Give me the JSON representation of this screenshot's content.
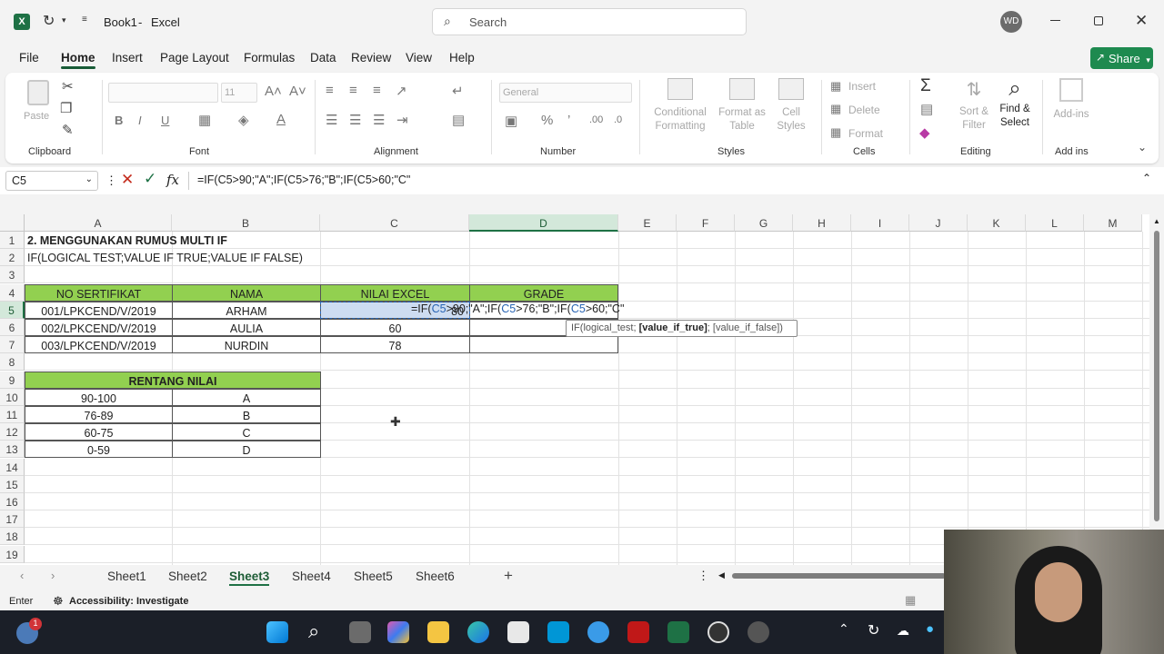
{
  "titlebar": {
    "doc_title": "Book1",
    "separator": "-",
    "app_name": "Excel",
    "search_placeholder": "Search",
    "user_initials": "WD"
  },
  "menu": {
    "items": [
      "File",
      "Home",
      "Insert",
      "Page Layout",
      "Formulas",
      "Data",
      "Review",
      "View",
      "Help"
    ],
    "share": "Share"
  },
  "ribbon": {
    "clipboard": {
      "label": "Clipboard",
      "paste": "Paste"
    },
    "font": {
      "label": "Font",
      "size": "11",
      "bold": "B",
      "italic": "I",
      "underline": "U"
    },
    "alignment": {
      "label": "Alignment"
    },
    "number": {
      "label": "Number",
      "format": "General"
    },
    "styles": {
      "label": "Styles",
      "cond1": "Conditional",
      "cond2": "Formatting",
      "fmt1": "Format as",
      "fmt2": "Table",
      "cell1": "Cell",
      "cell2": "Styles"
    },
    "cells": {
      "label": "Cells",
      "insert": "Insert",
      "delete": "Delete",
      "format": "Format"
    },
    "editing": {
      "label": "Editing",
      "sort1": "Sort &",
      "sort2": "Filter",
      "find1": "Find &",
      "find2": "Select"
    },
    "addins": {
      "label": "Add ins",
      "addins": "Add-ins"
    }
  },
  "formula_bar": {
    "name_box": "C5",
    "fx": "fx",
    "formula": "=IF(C5>90;\"A\";IF(C5>76;\"B\";IF(C5>60;\"C\""
  },
  "columns": [
    "A",
    "B",
    "C",
    "D",
    "E",
    "F",
    "G",
    "H",
    "I",
    "J",
    "K",
    "L",
    "M"
  ],
  "rows": [
    "1",
    "2",
    "3",
    "4",
    "5",
    "6",
    "7",
    "8",
    "9",
    "10",
    "11",
    "12",
    "13",
    "14",
    "15",
    "16",
    "17",
    "18",
    "19"
  ],
  "sheet": {
    "a1": "2. MENGGUNAKAN RUMUS MULTI IF",
    "a2": "IF(LOGICAL TEST;VALUE IF TRUE;VALUE IF FALSE)",
    "headers": [
      "NO SERTIFIKAT",
      "NAMA",
      "NILAI EXCEL",
      "GRADE"
    ],
    "data": [
      [
        "001/LPKCEND/V/2019",
        "ARHAM",
        "80"
      ],
      [
        "002/LPKCEND/V/2019",
        "AULIA",
        "60"
      ],
      [
        "003/LPKCEND/V/2019",
        "NURDIN",
        "78"
      ]
    ],
    "editing_formula": {
      "p1": "=IF(",
      "r1": "C5",
      "p2": ">90;\"A\";IF(",
      "r2": "C5",
      "p3": ">76;\"B\";IF(",
      "r3": "C5",
      "p4": ">60;\"C\""
    },
    "tooltip": {
      "a": "IF(logical_test; ",
      "b": "[value_if_true]",
      "c": "; [value_if_false])"
    },
    "rentang_title": "RENTANG NILAI",
    "rentang": [
      [
        "90-100",
        "A"
      ],
      [
        "76-89",
        "B"
      ],
      [
        "60-75",
        "C"
      ],
      [
        "0-59",
        "D"
      ]
    ]
  },
  "tabs": [
    "Sheet1",
    "Sheet2",
    "Sheet3",
    "Sheet4",
    "Sheet5",
    "Sheet6"
  ],
  "active_tab": "Sheet3",
  "status": {
    "mode": "Enter",
    "accessibility": "Accessibility: Investigate"
  },
  "taskbar": {
    "badge": "1"
  },
  "colors": {
    "excel_green": "#1e7145",
    "header_fill": "#92d050",
    "share": "#1e8a4f",
    "selection": "#cddcf1"
  }
}
